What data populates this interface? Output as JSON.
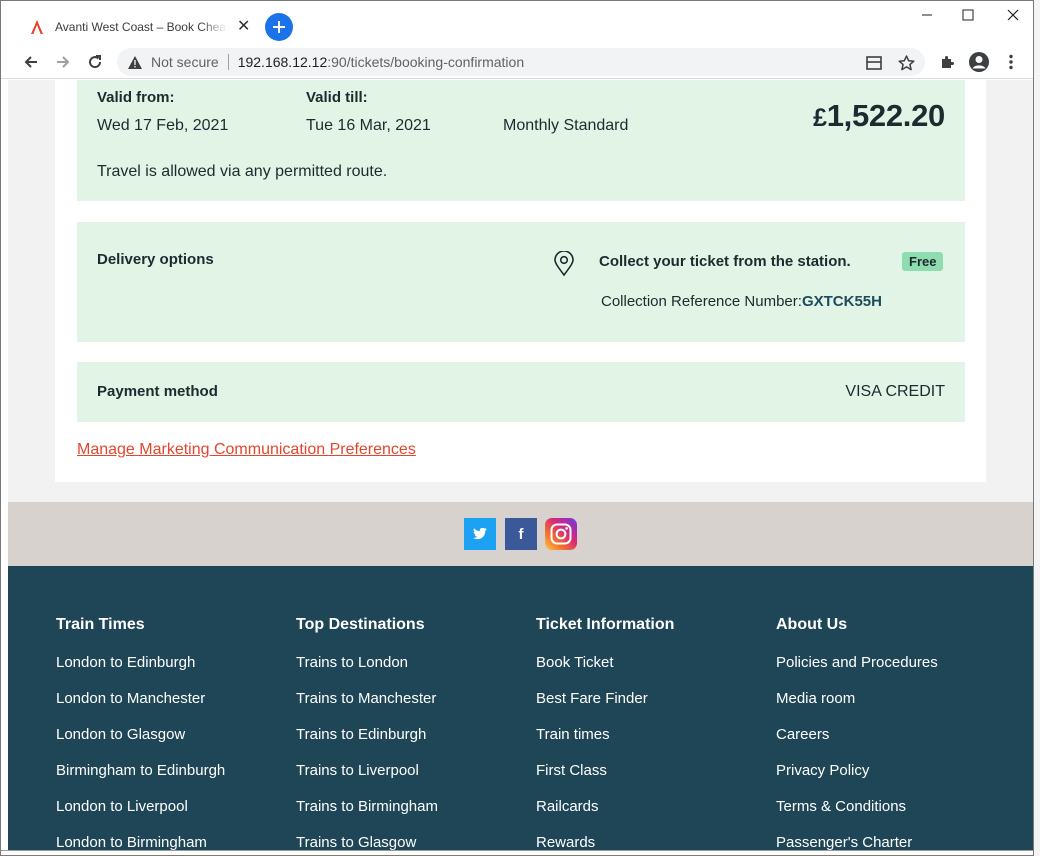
{
  "browser": {
    "tab_title": "Avanti West Coast – Book Cheap",
    "security_label": "Not secure",
    "url_host": "192.168.12.12",
    "url_rest": ":90/tickets/booking-confirmation",
    "accent_color": "#1a73e8"
  },
  "ticket": {
    "valid_from_label": "Valid from:",
    "valid_from_value": "Wed 17 Feb, 2021",
    "valid_till_label": "Valid till:",
    "valid_till_value": "Tue 16 Mar, 2021",
    "ticket_type": "Monthly Standard",
    "price_currency": "£",
    "price_amount": "1,522.20",
    "route_note": "Travel is allowed via any permitted route."
  },
  "delivery": {
    "heading": "Delivery options",
    "collect_text": "Collect your ticket from the station.",
    "badge": "Free",
    "ref_label": "Collection Reference Number:",
    "ref_code": "GXTCK55H"
  },
  "payment": {
    "heading": "Payment method",
    "method": "VISA CREDIT"
  },
  "manage_link": "Manage Marketing Communication Preferences",
  "social": {
    "twitter_glyph": "t",
    "facebook_glyph": "f"
  },
  "footer": {
    "columns": [
      {
        "heading": "Train Times",
        "links": [
          "London to Edinburgh",
          "London to Manchester",
          "London to Glasgow",
          "Birmingham to Edinburgh",
          "London to Liverpool",
          "London to Birmingham"
        ]
      },
      {
        "heading": "Top Destinations",
        "links": [
          "Trains to London",
          "Trains to Manchester",
          "Trains to Edinburgh",
          "Trains to Liverpool",
          "Trains to Birmingham",
          "Trains to Glasgow"
        ]
      },
      {
        "heading": "Ticket Information",
        "links": [
          "Book Ticket",
          "Best Fare Finder",
          "Train times",
          "First Class",
          "Railcards",
          "Rewards"
        ]
      },
      {
        "heading": "About Us",
        "links": [
          "Policies and Procedures",
          "Media room",
          "Careers",
          "Privacy Policy",
          "Terms & Conditions",
          "Passenger's Charter"
        ]
      }
    ]
  }
}
